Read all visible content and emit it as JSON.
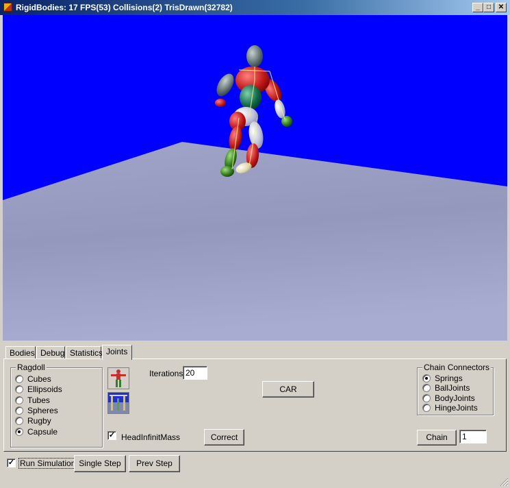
{
  "window": {
    "title": "RigidBodies: 17 FPS(53) Collisions(2) TrisDrawn(32782)",
    "title_buttons": [
      "_",
      "□",
      "✕"
    ]
  },
  "colors": {
    "sky": "#0000ff",
    "floor": "#a4a8c8",
    "titlebar": "#0a246a",
    "face": "#d4d0c8"
  },
  "tabs": [
    {
      "label": "Bodies",
      "active": false
    },
    {
      "label": "Debug",
      "active": false
    },
    {
      "label": "Statistics",
      "active": false
    },
    {
      "label": "Joints",
      "active": true
    }
  ],
  "ragdoll": {
    "legend": "Ragdoll",
    "options": [
      {
        "label": "Cubes",
        "checked": false
      },
      {
        "label": "Ellipsoids",
        "checked": false
      },
      {
        "label": "Tubes",
        "checked": false
      },
      {
        "label": "Spheres",
        "checked": false
      },
      {
        "label": "Rugby",
        "checked": false
      },
      {
        "label": "Capsule",
        "checked": true
      }
    ]
  },
  "joints": {
    "iterations_label": "Iterations",
    "iterations_value": "20",
    "car_button": "CAR",
    "head_infinit_mass_label": "HeadInfinitMass",
    "head_infinit_mass_checked": true,
    "correct_button": "Correct",
    "chain_button": "Chain",
    "chain_value": "1"
  },
  "chain_connectors": {
    "legend": "Chain Connectors",
    "options": [
      {
        "label": "Springs",
        "checked": true
      },
      {
        "label": "BallJoints",
        "checked": false
      },
      {
        "label": "BodyJoints",
        "checked": false
      },
      {
        "label": "HingeJoints",
        "checked": false
      }
    ]
  },
  "bottom": {
    "run_simulation_label": "Run Simulation",
    "run_simulation_checked": true,
    "single_step_button": "Single Step",
    "prev_step_button": "Prev Step"
  }
}
